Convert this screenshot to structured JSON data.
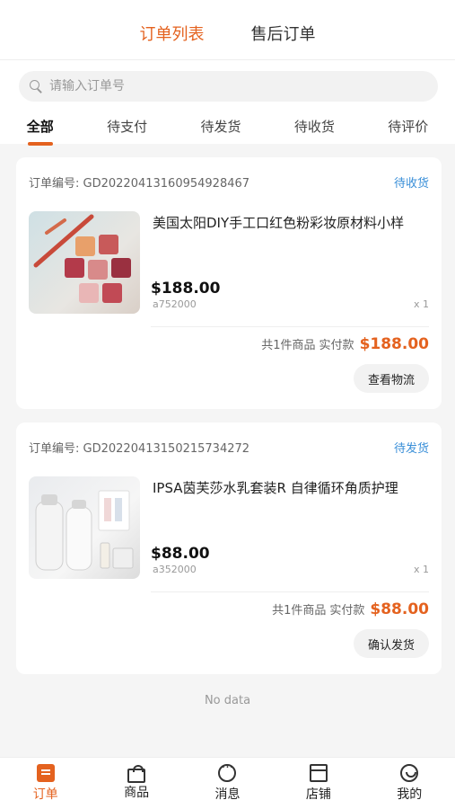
{
  "header": {
    "tabs": [
      {
        "label": "订单列表",
        "active": true
      },
      {
        "label": "售后订单",
        "active": false
      }
    ]
  },
  "search": {
    "placeholder": "请输入订单号"
  },
  "status_tabs": [
    {
      "label": "全部",
      "active": true
    },
    {
      "label": "待支付"
    },
    {
      "label": "待发货"
    },
    {
      "label": "待收货"
    },
    {
      "label": "待评价"
    }
  ],
  "orders": [
    {
      "order_label": "订单编号:",
      "order_no": "GD20220413160954928467",
      "status": "待收货",
      "title": "美国太阳DIY手工口红色粉彩妆原材料小样",
      "price": "$188.00",
      "sku": "a752000",
      "qty": "x 1",
      "summary_count": "共1件商品",
      "summary_paid": "实付款",
      "total": "$188.00",
      "action": "查看物流"
    },
    {
      "order_label": "订单编号:",
      "order_no": "GD20220413150215734272",
      "status": "待发货",
      "title": "IPSA茵芙莎水乳套装R 自律循环角质护理",
      "price": "$88.00",
      "sku": "a352000",
      "qty": "x 1",
      "summary_count": "共1件商品",
      "summary_paid": "实付款",
      "total": "$88.00",
      "action": "确认发货"
    }
  ],
  "empty_text": "No data",
  "tabbar": [
    {
      "label": "订单",
      "icon": "order-icon",
      "active": true
    },
    {
      "label": "商品",
      "icon": "bag-icon"
    },
    {
      "label": "消息",
      "icon": "message-icon"
    },
    {
      "label": "店铺",
      "icon": "shop-icon"
    },
    {
      "label": "我的",
      "icon": "profile-icon"
    }
  ],
  "colors": {
    "accent": "#e4621f",
    "status": "#3a8fd8"
  }
}
